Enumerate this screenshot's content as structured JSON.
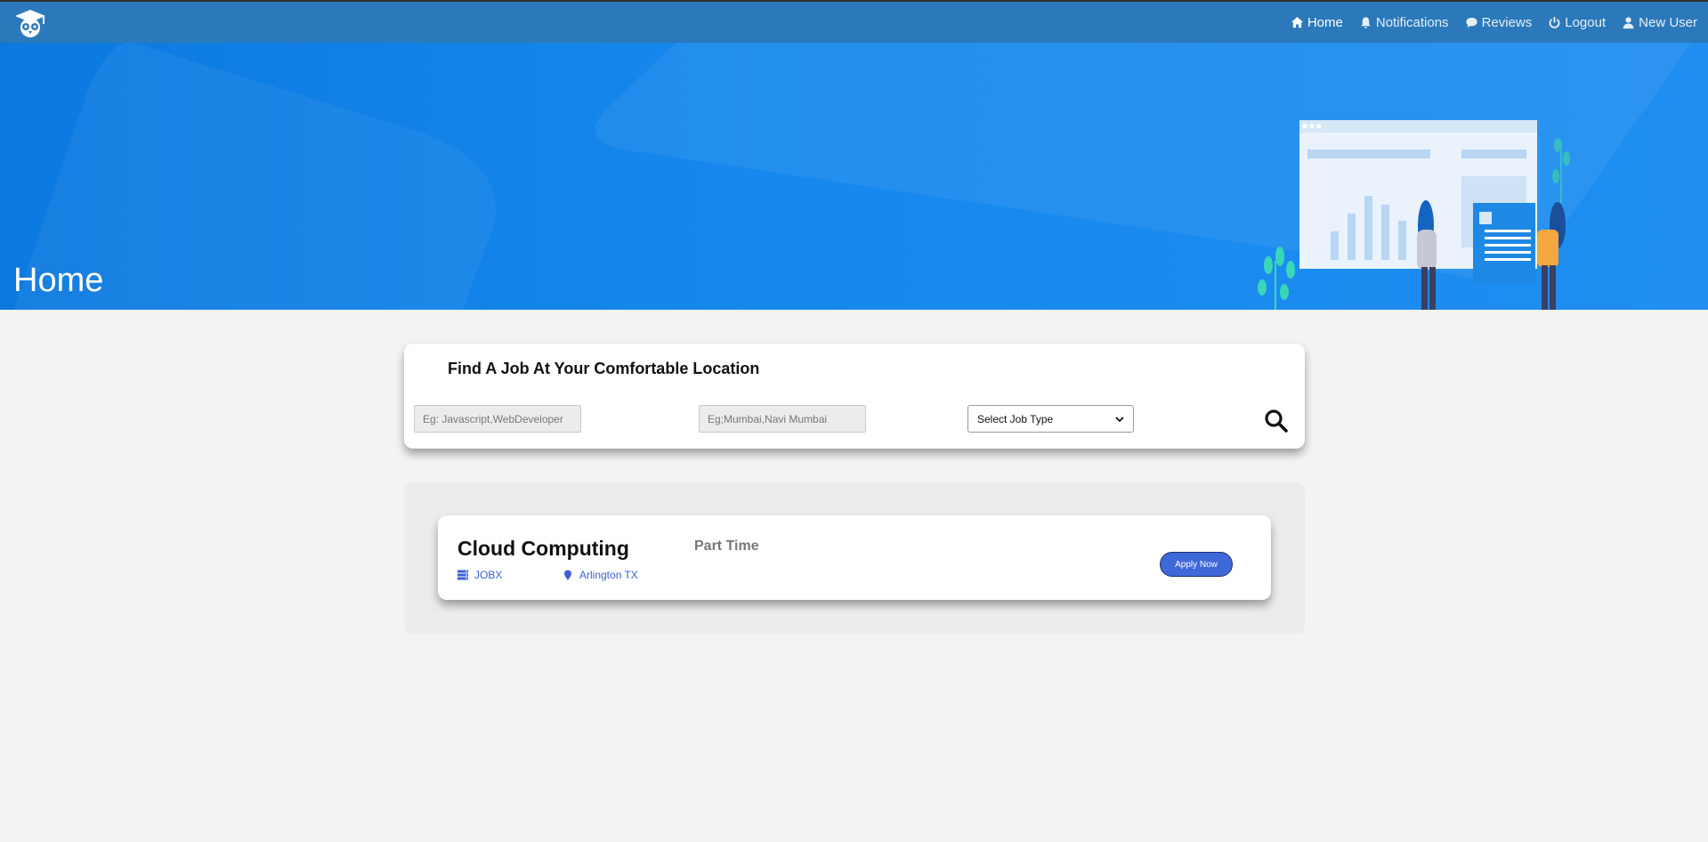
{
  "nav": {
    "items": [
      {
        "label": "Home",
        "icon": "home-icon",
        "active": true
      },
      {
        "label": "Notifications",
        "icon": "bell-icon",
        "active": false
      },
      {
        "label": "Reviews",
        "icon": "comment-icon",
        "active": false
      },
      {
        "label": "Logout",
        "icon": "power-icon",
        "active": false
      },
      {
        "label": "New User",
        "icon": "user-icon",
        "active": false
      }
    ]
  },
  "hero": {
    "title": "Home"
  },
  "search": {
    "title": "Find A Job At Your Comfortable Location",
    "skill_placeholder": "Eg: Javascript,WebDeveloper",
    "location_placeholder": "Eg;Mumbai,Navi Mumbai",
    "job_type_selected": "Select Job Type"
  },
  "jobs": [
    {
      "title": "Cloud Computing",
      "type": "Part Time",
      "company": "JOBX",
      "location": "Arlington TX",
      "apply_label": "Apply Now"
    }
  ],
  "colors": {
    "navbar": "#2b79ba",
    "hero": "#1688ee",
    "accent": "#3f68d8",
    "link": "#3d5fd6"
  }
}
